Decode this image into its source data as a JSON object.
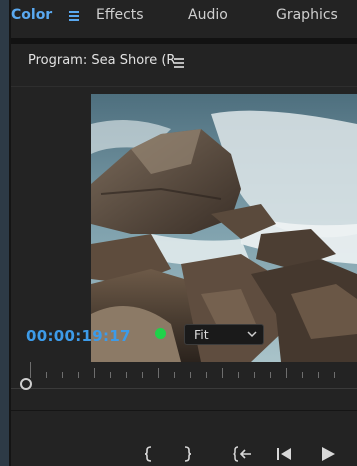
{
  "workspace_tabs": [
    {
      "label": "Color",
      "active": true
    },
    {
      "label": "Effects",
      "active": false
    },
    {
      "label": "Audio",
      "active": false
    },
    {
      "label": "Graphics",
      "active": false
    }
  ],
  "program_monitor": {
    "title": "Program: Sea Shore (R",
    "timecode": "00:00:19:17",
    "zoom_select": "Fit",
    "status_color": "#1fd24a"
  },
  "icons": [
    "workspace-menu-icon",
    "panel-menu-icon",
    "chevron-down-icon",
    "mark-in-icon",
    "mark-out-icon",
    "go-to-in-icon",
    "step-back-icon",
    "play-icon"
  ],
  "colors": {
    "accent": "#3d9be9",
    "panel_bg": "#232323"
  }
}
